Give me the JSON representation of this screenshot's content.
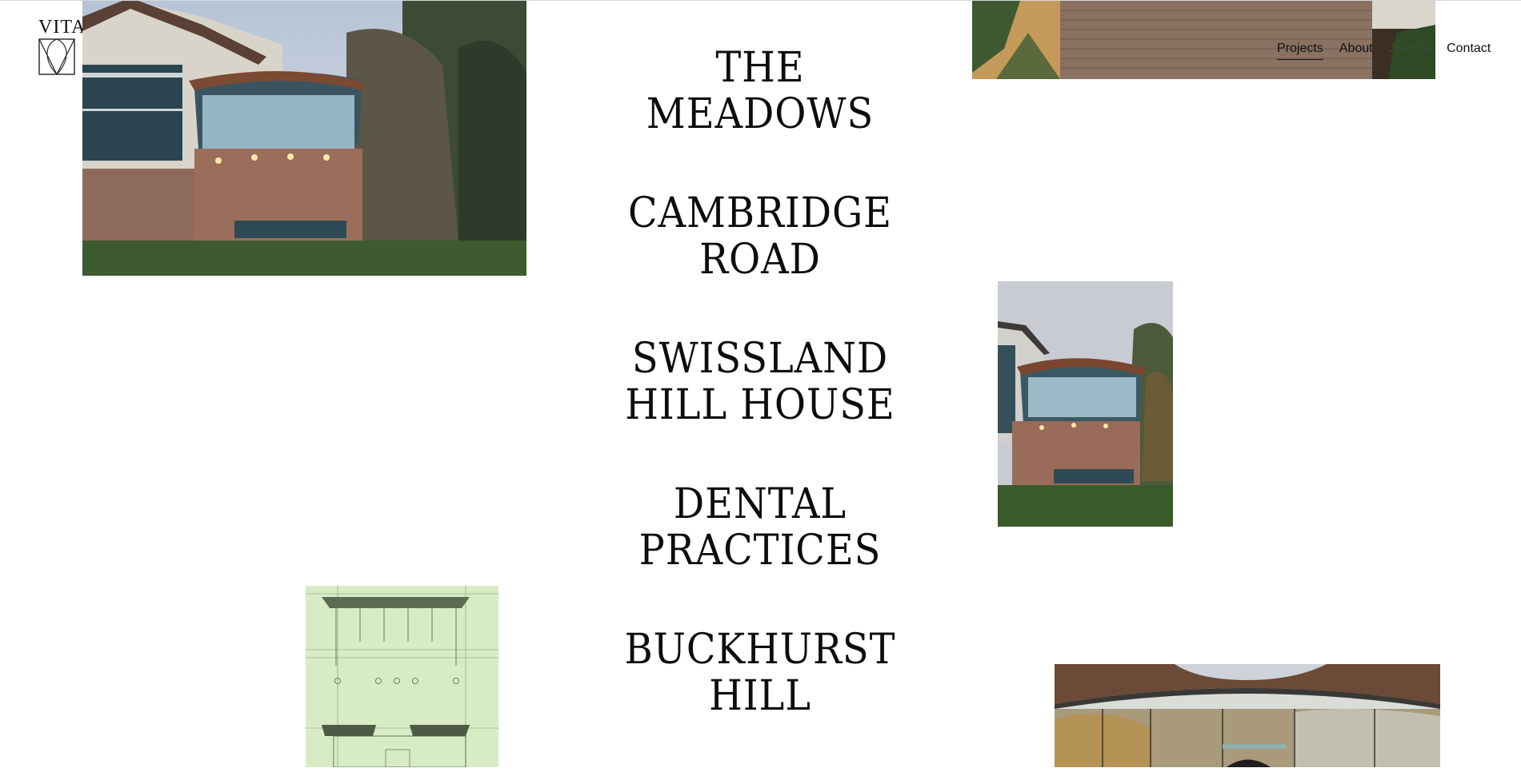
{
  "logo": {
    "text": "VITA"
  },
  "nav": {
    "items": [
      {
        "label": "Projects"
      },
      {
        "label": "About"
      },
      {
        "label": "Journal"
      },
      {
        "label": "Contact"
      }
    ]
  },
  "projects": [
    {
      "line1": "THE",
      "line2": "MEADOWS"
    },
    {
      "line1": "CAMBRIDGE",
      "line2": "ROAD"
    },
    {
      "line1": "SWISSLAND",
      "line2": "HILL HOUSE"
    },
    {
      "line1": "DENTAL",
      "line2": "PRACTICES"
    },
    {
      "line1": "BUCKHURST",
      "line2": "HILL"
    }
  ]
}
